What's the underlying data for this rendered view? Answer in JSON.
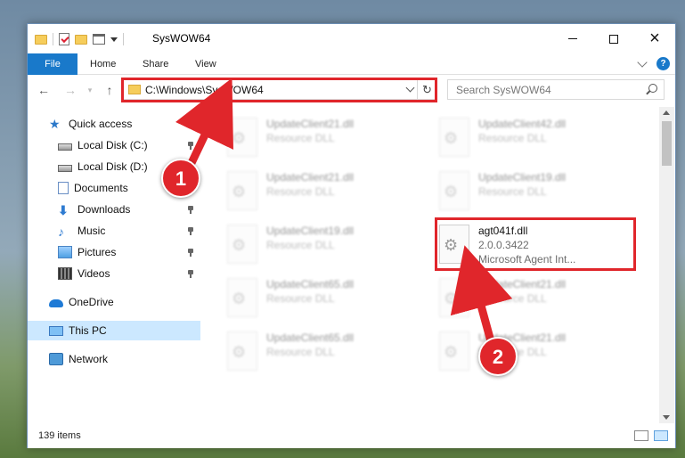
{
  "window": {
    "title": "SysWOW64",
    "controls": {
      "minimize": "minimize",
      "maximize": "maximize",
      "close": "×"
    }
  },
  "ribbon": {
    "tabs": [
      "File",
      "Home",
      "Share",
      "View"
    ],
    "help": "?"
  },
  "nav": {
    "back": "←",
    "forward": "→",
    "up": "↑",
    "address": "C:\\Windows\\SysWOW64",
    "refresh": "↻",
    "search_placeholder": "Search SysWOW64"
  },
  "sidebar": {
    "items": [
      {
        "label": "Quick access",
        "icon": "star-icon",
        "pinned": false
      },
      {
        "label": "Local Disk (C:)",
        "icon": "drive-icon",
        "pinned": true
      },
      {
        "label": "Local Disk (D:)",
        "icon": "drive-icon",
        "pinned": true
      },
      {
        "label": "Documents",
        "icon": "documents-icon",
        "pinned": true
      },
      {
        "label": "Downloads",
        "icon": "downloads-icon",
        "pinned": true
      },
      {
        "label": "Music",
        "icon": "music-icon",
        "pinned": true
      },
      {
        "label": "Pictures",
        "icon": "pictures-icon",
        "pinned": true
      },
      {
        "label": "Videos",
        "icon": "videos-icon",
        "pinned": true
      },
      {
        "label": "OneDrive",
        "icon": "onedrive-icon",
        "pinned": false
      },
      {
        "label": "This PC",
        "icon": "this-pc-icon",
        "pinned": false,
        "selected": true
      },
      {
        "label": "Network",
        "icon": "network-icon",
        "pinned": false
      }
    ]
  },
  "files": [
    {
      "name": "UpdateClient21.dll",
      "type": "Resource DLL"
    },
    {
      "name": "UpdateClient42.dll",
      "type": "Resource DLL"
    },
    {
      "name": "UpdateClient21.dll",
      "type": "Resource DLL"
    },
    {
      "name": "UpdateClient19.dll",
      "type": "Resource DLL"
    },
    {
      "name": "UpdateClient19.dll",
      "type": "Resource DLL"
    },
    {
      "name": "agt041f.dll",
      "version": "2.0.0.3422",
      "type": "Microsoft Agent Int...",
      "highlighted": true
    },
    {
      "name": "UpdateClient65.dll",
      "type": "Resource DLL"
    },
    {
      "name": "UpdateClient21.dll",
      "type": "Resource DLL"
    },
    {
      "name": "UpdateClient65.dll",
      "type": "Resource DLL"
    },
    {
      "name": "UpdateClient21.dll",
      "type": "Resource DLL"
    }
  ],
  "status": {
    "items_count": "139 items"
  },
  "callouts": [
    "1",
    "2"
  ],
  "colors": {
    "accent": "#1979ca",
    "highlight_red": "#e0262b",
    "selected_bg": "#cce8ff"
  }
}
